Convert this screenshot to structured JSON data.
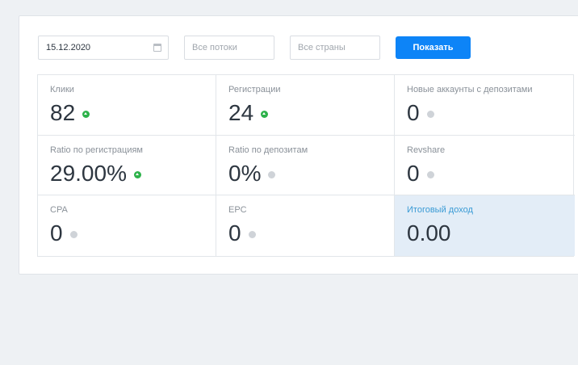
{
  "filters": {
    "date_value": "15.12.2020",
    "streams_placeholder": "Все потоки",
    "countries_placeholder": "Все страны",
    "show_button_label": "Показать"
  },
  "stats": [
    {
      "label": "Клики",
      "value": "82",
      "trend": "up"
    },
    {
      "label": "Регистрации",
      "value": "24",
      "trend": "up"
    },
    {
      "label": "Новые аккаунты с депозитами",
      "value": "0",
      "trend": "neutral"
    },
    {
      "label": "Ratio по регистрациям",
      "value": "29.00%",
      "trend": "up"
    },
    {
      "label": "Ratio по депозитам",
      "value": "0%",
      "trend": "neutral"
    },
    {
      "label": "Revshare",
      "value": "0",
      "trend": "neutral"
    },
    {
      "label": "CPA",
      "value": "0",
      "trend": "neutral"
    },
    {
      "label": "EPC",
      "value": "0",
      "trend": "neutral"
    },
    {
      "label": "Итоговый доход",
      "value": "0.00",
      "trend": "none"
    }
  ],
  "colors": {
    "accent": "#0d84f7",
    "trend_up": "#2db24a",
    "trend_neutral": "#cfd3d8",
    "highlight_bg": "#e3edf7",
    "highlight_label": "#3a9bd5"
  }
}
